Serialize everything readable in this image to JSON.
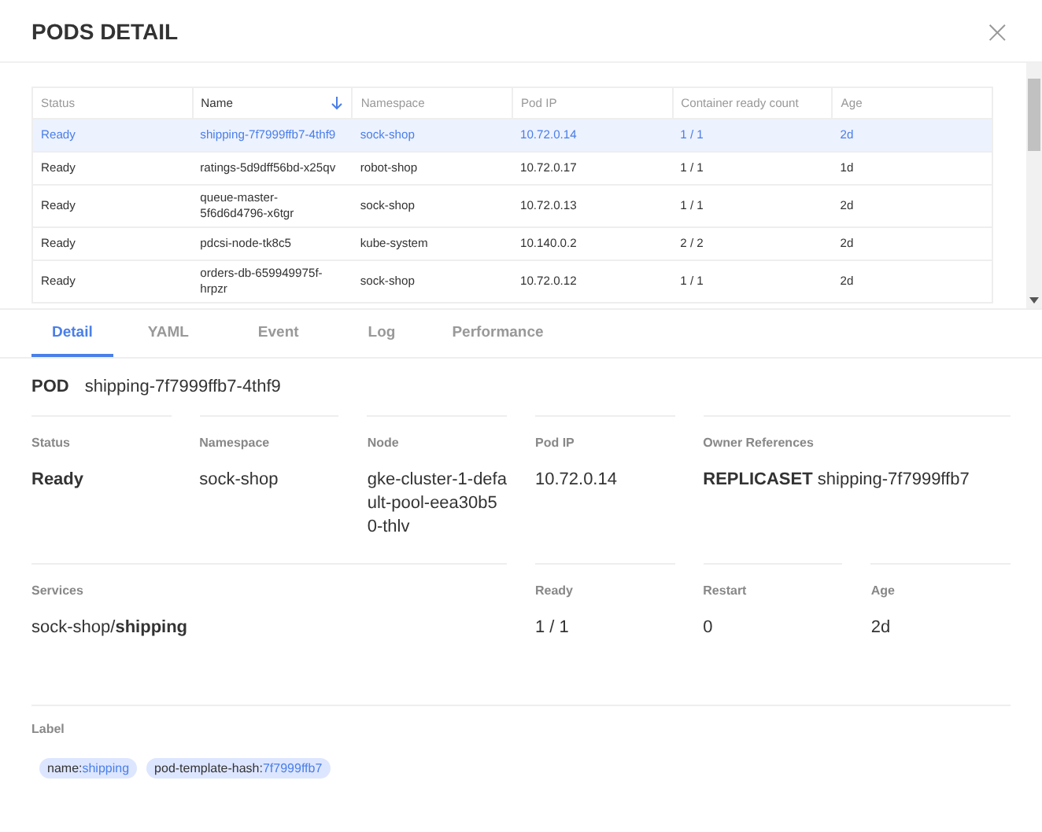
{
  "dialog": {
    "title": "PODS DETAIL",
    "close": "×"
  },
  "table": {
    "columns": [
      {
        "label": "Status",
        "sorted": false
      },
      {
        "label": "Name",
        "sorted": true
      },
      {
        "label": "Namespace",
        "sorted": false
      },
      {
        "label": "Pod IP",
        "sorted": false
      },
      {
        "label": "Container ready count",
        "sorted": false
      },
      {
        "label": "Age",
        "sorted": false
      }
    ],
    "rows": [
      {
        "selected": true,
        "cells": [
          "Ready",
          "shipping-7f7999ffb7-4thf9",
          "sock-shop",
          "10.72.0.14",
          "1 / 1",
          "2d"
        ]
      },
      {
        "selected": false,
        "cells": [
          "Ready",
          "ratings-5d9dff56bd-x25qv",
          "robot-shop",
          "10.72.0.17",
          "1 / 1",
          "1d"
        ]
      },
      {
        "selected": false,
        "cells": [
          "Ready",
          "queue-master-5f6d6d4796-x6tgr",
          "sock-shop",
          "10.72.0.13",
          "1 / 1",
          "2d"
        ]
      },
      {
        "selected": false,
        "cells": [
          "Ready",
          "pdcsi-node-tk8c5",
          "kube-system",
          "10.140.0.2",
          "2 / 2",
          "2d"
        ]
      },
      {
        "selected": false,
        "cells": [
          "Ready",
          "orders-db-659949975f-hrpzr",
          "sock-shop",
          "10.72.0.12",
          "1 / 1",
          "2d"
        ]
      }
    ]
  },
  "tabs": [
    {
      "label": "Detail",
      "selected": true
    },
    {
      "label": "YAML",
      "selected": false
    },
    {
      "label": "Event",
      "selected": false
    },
    {
      "label": "Log",
      "selected": false
    },
    {
      "label": "Performance",
      "selected": false
    }
  ],
  "detail": {
    "kind_label": "POD",
    "name": "shipping-7f7999ffb7-4thf9",
    "fields": [
      {
        "label": "Status",
        "value": "Ready",
        "bold": true
      },
      {
        "label": "Namespace",
        "value": "sock-shop",
        "bold": false
      },
      {
        "label": "Node",
        "value": "gke-cluster-1-default-pool-eea30b50-thlv",
        "bold": false
      },
      {
        "label": "Pod IP",
        "value": "10.72.0.14",
        "bold": false
      },
      {
        "label": "Owner References",
        "value": "**REPLICASET** shipping-7f7999ffb7",
        "bold": false
      },
      {
        "label": "Services",
        "value": "sock-shop/**shipping**",
        "bold": false
      },
      {
        "label": "Ready",
        "value": "1 / 1",
        "bold": false
      },
      {
        "label": "Restart",
        "value": "0",
        "bold": false
      },
      {
        "label": "Age",
        "value": "2d",
        "bold": false
      }
    ],
    "labels_title": "Label",
    "labels": [
      {
        "key": "name:",
        "value": "shipping"
      },
      {
        "key": "pod-template-hash:",
        "value": "7f7999ffb7"
      }
    ]
  }
}
